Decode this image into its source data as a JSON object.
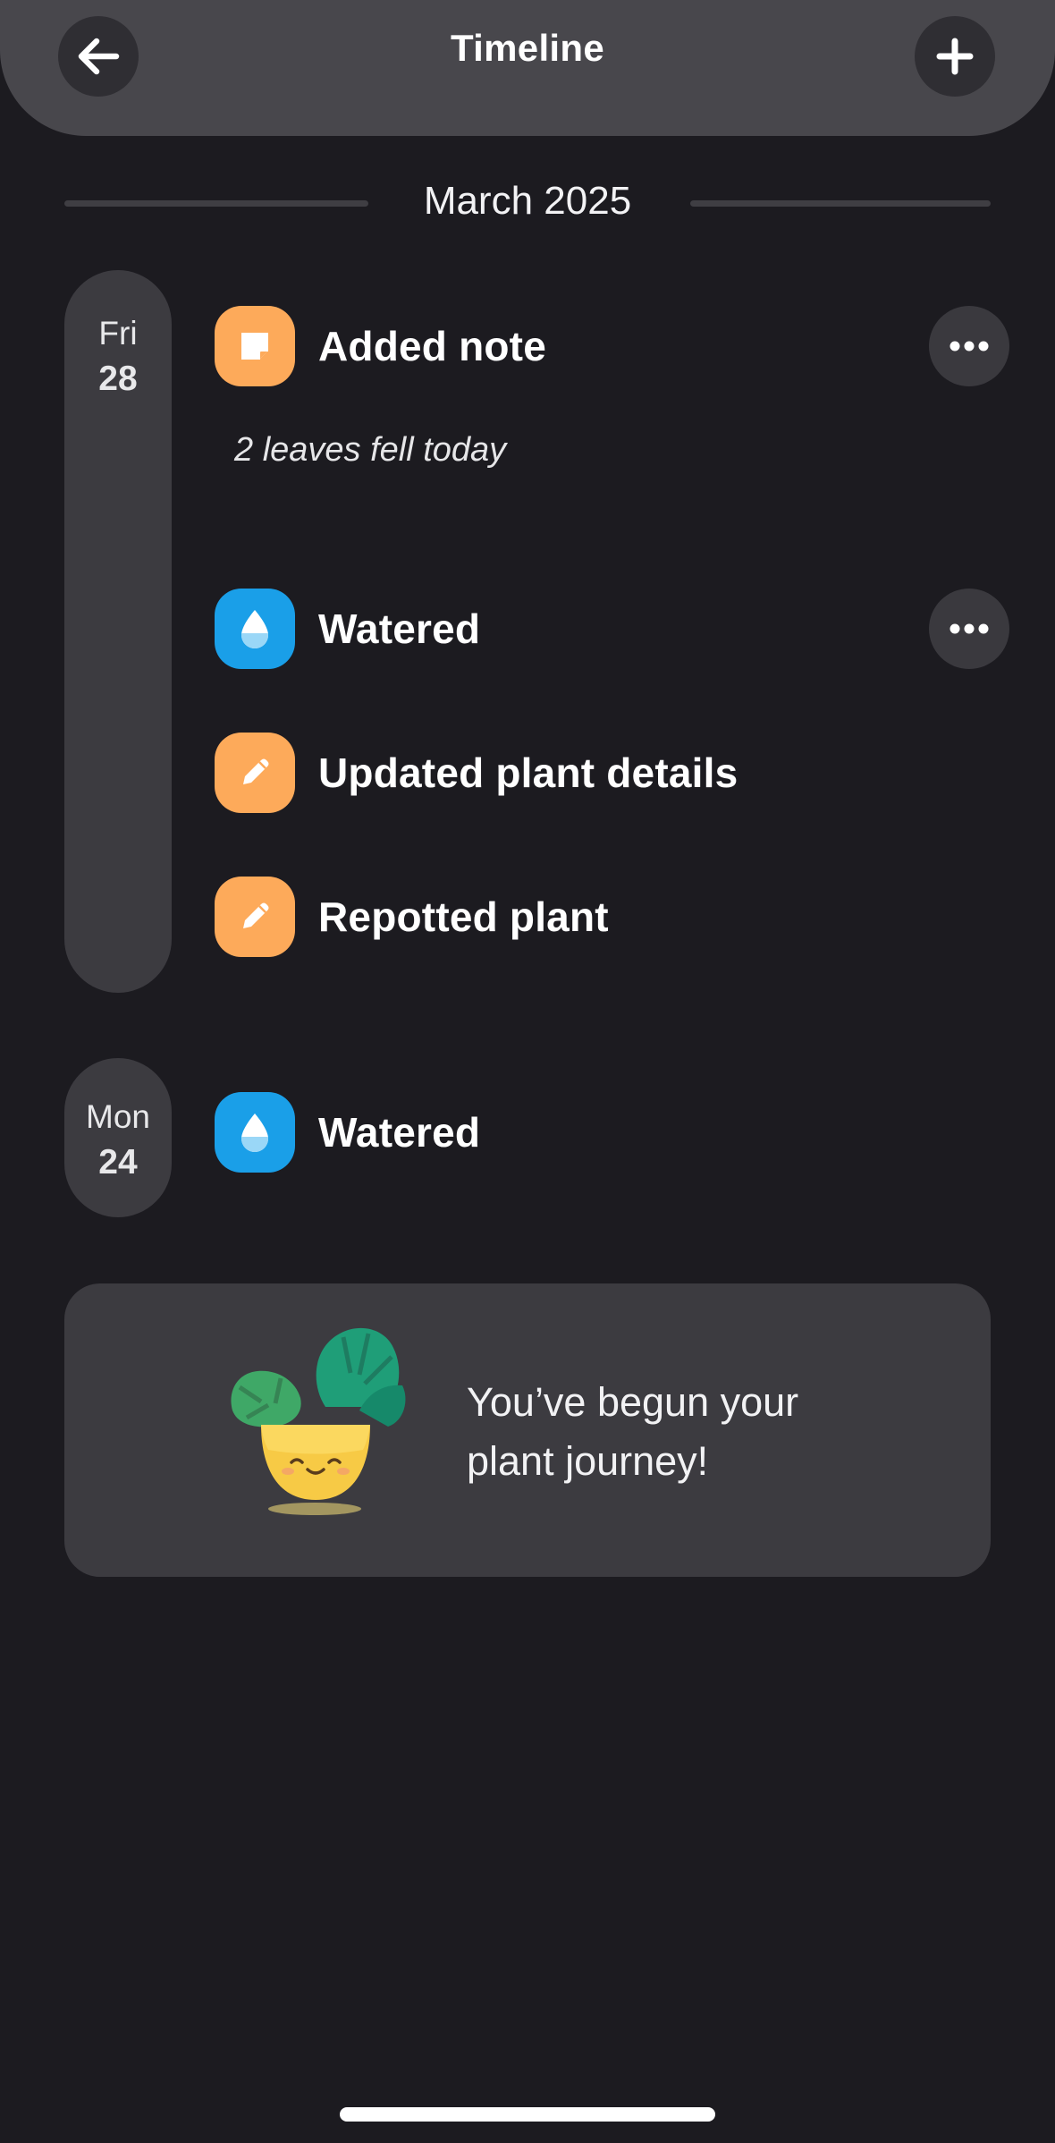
{
  "header": {
    "title": "Timeline",
    "back_icon": "arrow-left-icon",
    "add_icon": "plus-icon"
  },
  "month": {
    "label": "March 2025"
  },
  "days": [
    {
      "day_name": "Fri",
      "day_num": "28",
      "events": [
        {
          "label": "Added note",
          "icon": "note-icon",
          "color": "#fdaa5a",
          "note": "2 leaves fell today",
          "has_more": true
        },
        {
          "label": "Watered",
          "icon": "water-drop-icon",
          "color": "#1a9fe8",
          "has_more": true
        },
        {
          "label": "Updated plant details",
          "icon": "pencil-icon",
          "color": "#fdaa5a",
          "has_more": false
        },
        {
          "label": "Repotted plant",
          "icon": "pencil-icon",
          "color": "#fdaa5a",
          "has_more": false
        }
      ]
    },
    {
      "day_name": "Mon",
      "day_num": "24",
      "events": [
        {
          "label": "Watered",
          "icon": "water-drop-icon",
          "color": "#1a9fe8",
          "has_more": false
        }
      ]
    }
  ],
  "journey": {
    "message": "You’ve begun your plant journey!",
    "illustration": "potted-plant-illustration"
  },
  "colors": {
    "background": "#1c1b20",
    "header": "#48474c",
    "pill": "#3c3b40",
    "orange": "#fdaa5a",
    "blue": "#1a9fe8"
  }
}
